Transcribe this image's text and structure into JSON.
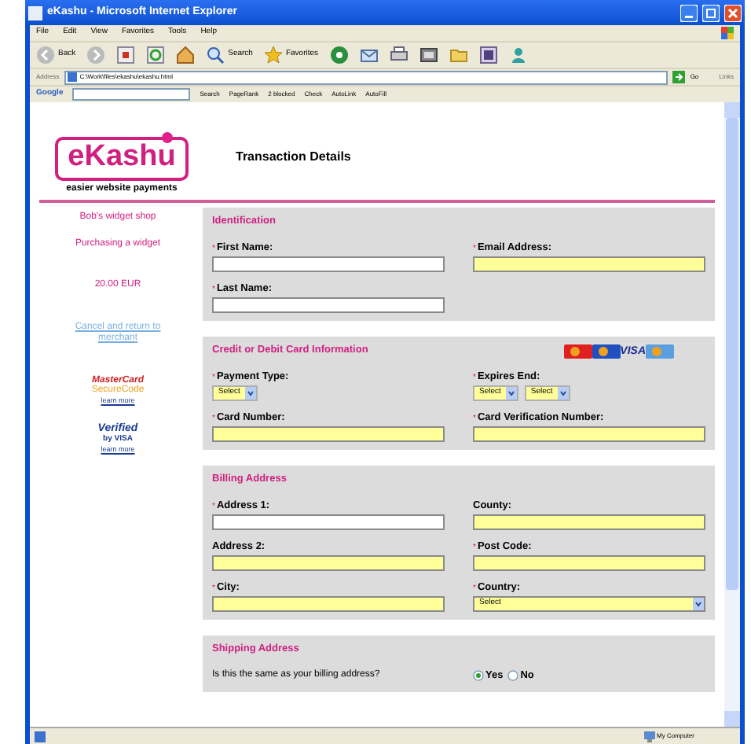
{
  "window": {
    "title": "eKashu - Microsoft Internet Explorer"
  },
  "menu": [
    "File",
    "Edit",
    "View",
    "Favorites",
    "Tools",
    "Help"
  ],
  "toolbar": [
    {
      "kind": "back",
      "label": "Back"
    },
    {
      "kind": "forward"
    },
    {
      "kind": "stop"
    },
    {
      "kind": "refresh"
    },
    {
      "kind": "home"
    },
    {
      "kind": "search",
      "label": "Search"
    },
    {
      "kind": "favorites",
      "label": "Favorites"
    },
    {
      "kind": "media"
    },
    {
      "kind": "mail"
    },
    {
      "kind": "print"
    },
    {
      "kind": "edit"
    },
    {
      "kind": "folder"
    },
    {
      "kind": "research"
    },
    {
      "kind": "messenger"
    }
  ],
  "address": {
    "label": "Address",
    "value": "C:\\Work\\files\\ekashu\\ekashu.html",
    "go": "Go",
    "links": "Links"
  },
  "google_toolbar": {
    "logo": "Google",
    "items": [
      "Search",
      "PageRank",
      "2 blocked",
      "Check",
      "AutoLink",
      "AutoFill"
    ]
  },
  "page": {
    "logo": "eKashu",
    "tagline": "easier website payments",
    "heading": "Transaction Details",
    "sidebar": {
      "shop": "Bob's widget shop",
      "purpose": "Purchasing a widget",
      "amount": "20.00 EUR",
      "cancel_link": "Cancel and return to merchant",
      "badges": [
        {
          "kind": "mastercard",
          "lines": [
            "MasterCard",
            "SecureCode"
          ],
          "link": "learn more"
        },
        {
          "kind": "visa",
          "lines": [
            "Verified",
            "by VISA"
          ],
          "link": "learn more"
        }
      ]
    },
    "sections": [
      {
        "title": "Identification",
        "rows": [
          [
            {
              "label": "First Name:",
              "required_mark": "*",
              "kind": "text",
              "autofill": false
            },
            {
              "label": "Email Address:",
              "required_mark": "*",
              "kind": "text",
              "autofill": true
            }
          ],
          [
            {
              "label": "Last Name:",
              "required_mark": "*",
              "kind": "text",
              "autofill": false
            }
          ]
        ]
      },
      {
        "title": "Credit or Debit Card Information",
        "card_logos": [
          {
            "kind": "mastercard"
          },
          {
            "kind": "maestro"
          },
          {
            "kind": "visa",
            "text": "VISA"
          },
          {
            "kind": "amex"
          }
        ],
        "rows": [
          [
            {
              "label": "Payment Type:",
              "required_mark": "*",
              "kind": "select",
              "selects": [
                "Select"
              ]
            },
            {
              "label": "Expires End:",
              "required_mark": "*",
              "kind": "select",
              "selects": [
                "Select",
                "Select"
              ]
            }
          ],
          [
            {
              "label": "Card Number:",
              "required_mark": "*",
              "kind": "text",
              "autofill": true
            },
            {
              "label": "Card Verification Number:",
              "required_mark": "*",
              "kind": "text",
              "autofill": true
            }
          ]
        ]
      },
      {
        "title": "Billing Address",
        "rows": [
          [
            {
              "label": "Address 1:",
              "required_mark": "*",
              "kind": "text",
              "autofill": false
            },
            {
              "label": "County:",
              "kind": "text",
              "autofill": true
            }
          ],
          [
            {
              "label": "Address 2:",
              "kind": "text",
              "autofill": true
            },
            {
              "label": "Post Code:",
              "required_mark": "*",
              "kind": "text",
              "autofill": true
            }
          ],
          [
            {
              "label": "City:",
              "required_mark": "*",
              "kind": "text",
              "autofill": true
            },
            {
              "label": "Country:",
              "required_mark": "*",
              "kind": "wide_select",
              "value": "Select"
            }
          ]
        ]
      },
      {
        "title": "Shipping Address",
        "question": "Is this the same as your billing address?",
        "options": [
          {
            "label": "Yes",
            "selected": true
          },
          {
            "label": "No",
            "selected": false
          }
        ]
      }
    ]
  },
  "status_bar": {
    "zone": "My Computer"
  }
}
